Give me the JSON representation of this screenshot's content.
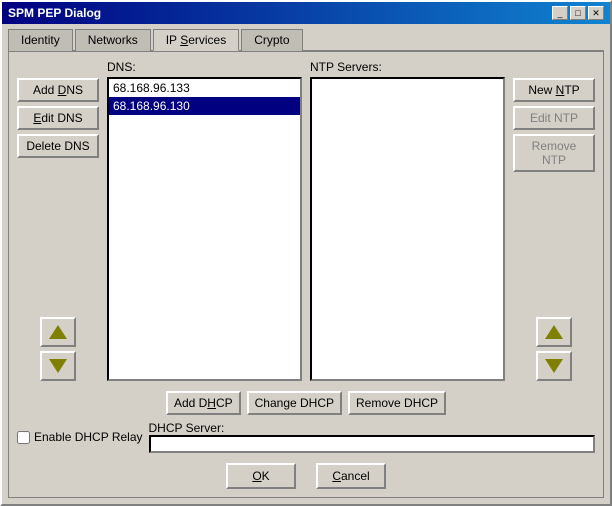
{
  "window": {
    "title": "SPM PEP Dialog",
    "controls": [
      "_",
      "□",
      "✕"
    ]
  },
  "tabs": [
    {
      "label": "Identity",
      "underline_index": 0,
      "active": false
    },
    {
      "label": "Networks",
      "underline_index": 0,
      "active": false
    },
    {
      "label": "IP Services",
      "underline_index": 3,
      "active": true
    },
    {
      "label": "Crypto",
      "underline_index": 0,
      "active": false
    }
  ],
  "dns": {
    "label": "DNS:",
    "items": [
      {
        "value": "68.168.96.133",
        "selected": false
      },
      {
        "value": "68.168.96.130",
        "selected": true
      }
    ],
    "buttons": {
      "add": "Add DNS",
      "edit": "Edit DNS",
      "delete": "Delete DNS"
    },
    "add_underline": 4,
    "edit_underline": 0,
    "delete_underline": 0
  },
  "ntp": {
    "label": "NTP Servers:",
    "items": [],
    "buttons": {
      "new": "New NTP",
      "edit": "Edit NTP",
      "remove": "Remove NTP"
    }
  },
  "dhcp": {
    "add_label": "Add DHCP",
    "change_label": "Change DHCP",
    "remove_label": "Remove DHCP",
    "server_label": "DHCP Server:",
    "enable_relay_label": "Enable DHCP Relay",
    "server_value": ""
  },
  "footer": {
    "ok_label": "OK",
    "cancel_label": "Cancel"
  }
}
